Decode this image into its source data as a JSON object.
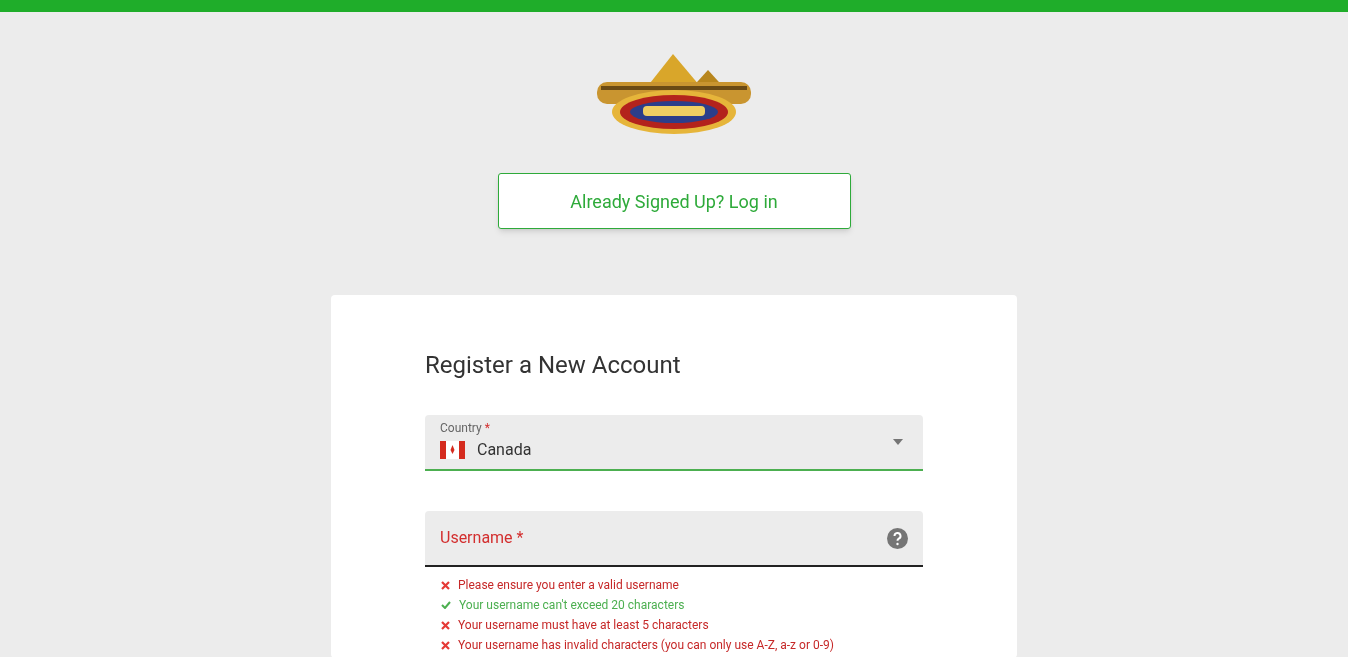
{
  "login_button": "Already Signed Up? Log in",
  "form": {
    "title": "Register a New Account",
    "country": {
      "label": "Country",
      "required": "*",
      "value": "Canada",
      "error": false
    },
    "username": {
      "placeholder": "Username",
      "required": "*",
      "error": true
    },
    "rules": [
      {
        "text": "Please ensure you enter a valid username",
        "passed": false
      },
      {
        "text": "Your username can't exceed 20 characters",
        "passed": true
      },
      {
        "text": "Your username must have at least 5 characters",
        "passed": false
      },
      {
        "text": "Your username has invalid characters (you can only use A-Z, a-z or 0-9)",
        "passed": false
      }
    ]
  }
}
